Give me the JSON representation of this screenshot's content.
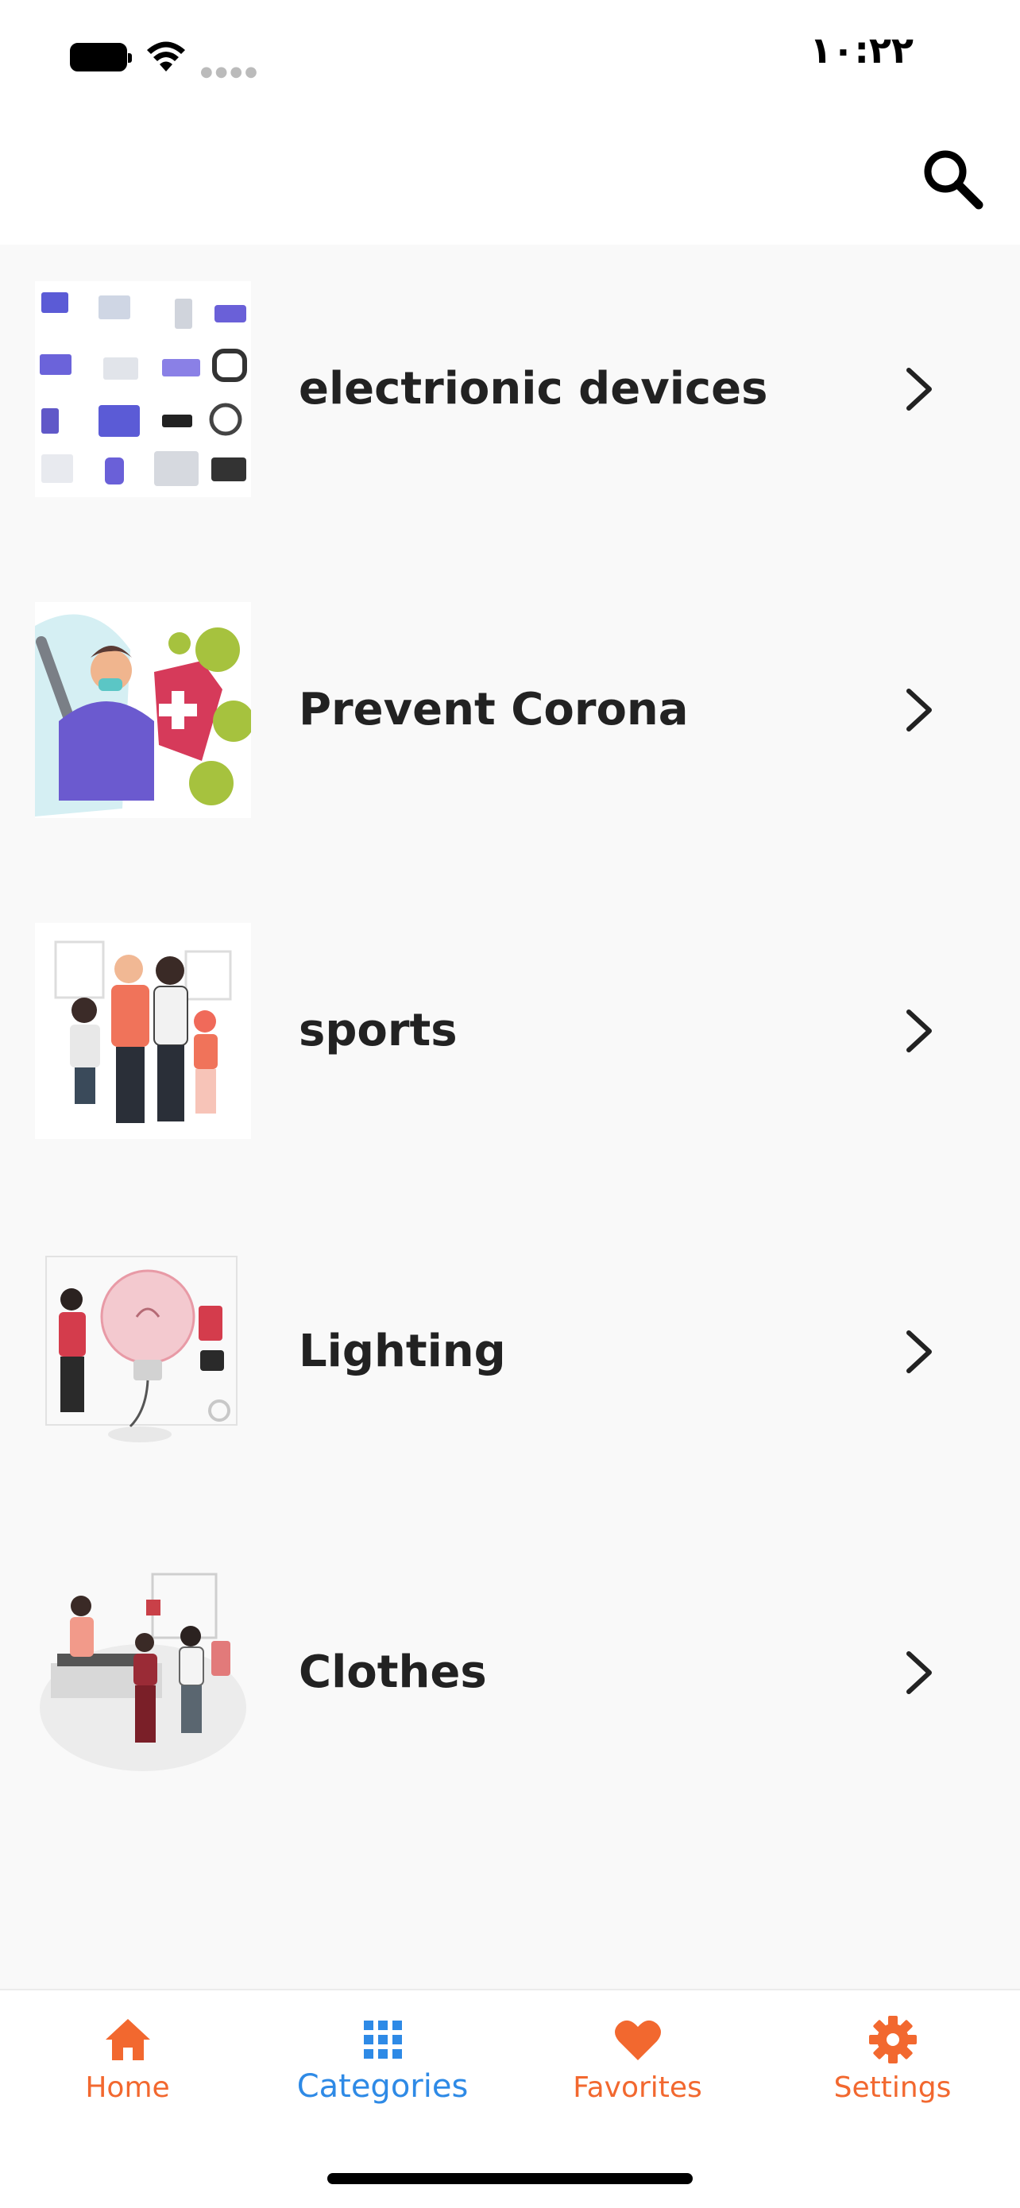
{
  "status_bar": {
    "time": "١٠:٢٢"
  },
  "categories": [
    {
      "title": "electrionic devices",
      "image": "electronic-devices-illustration"
    },
    {
      "title": "Prevent Corona",
      "image": "prevent-corona-illustration"
    },
    {
      "title": "sports",
      "image": "family-sports-illustration"
    },
    {
      "title": "Lighting",
      "image": "lightbulb-illustration"
    },
    {
      "title": "Clothes",
      "image": "clothes-shop-illustration"
    }
  ],
  "tabbar": {
    "active": "Categories",
    "tabs": [
      {
        "label": "Home",
        "icon": "home-icon"
      },
      {
        "label": "Categories",
        "icon": "grid-icon"
      },
      {
        "label": "Favorites",
        "icon": "heart-icon"
      },
      {
        "label": "Settings",
        "icon": "gear-icon"
      }
    ]
  },
  "colors": {
    "accent": "#f2682f",
    "active_tab": "#2e8ae6",
    "background": "#f9f9f9"
  }
}
